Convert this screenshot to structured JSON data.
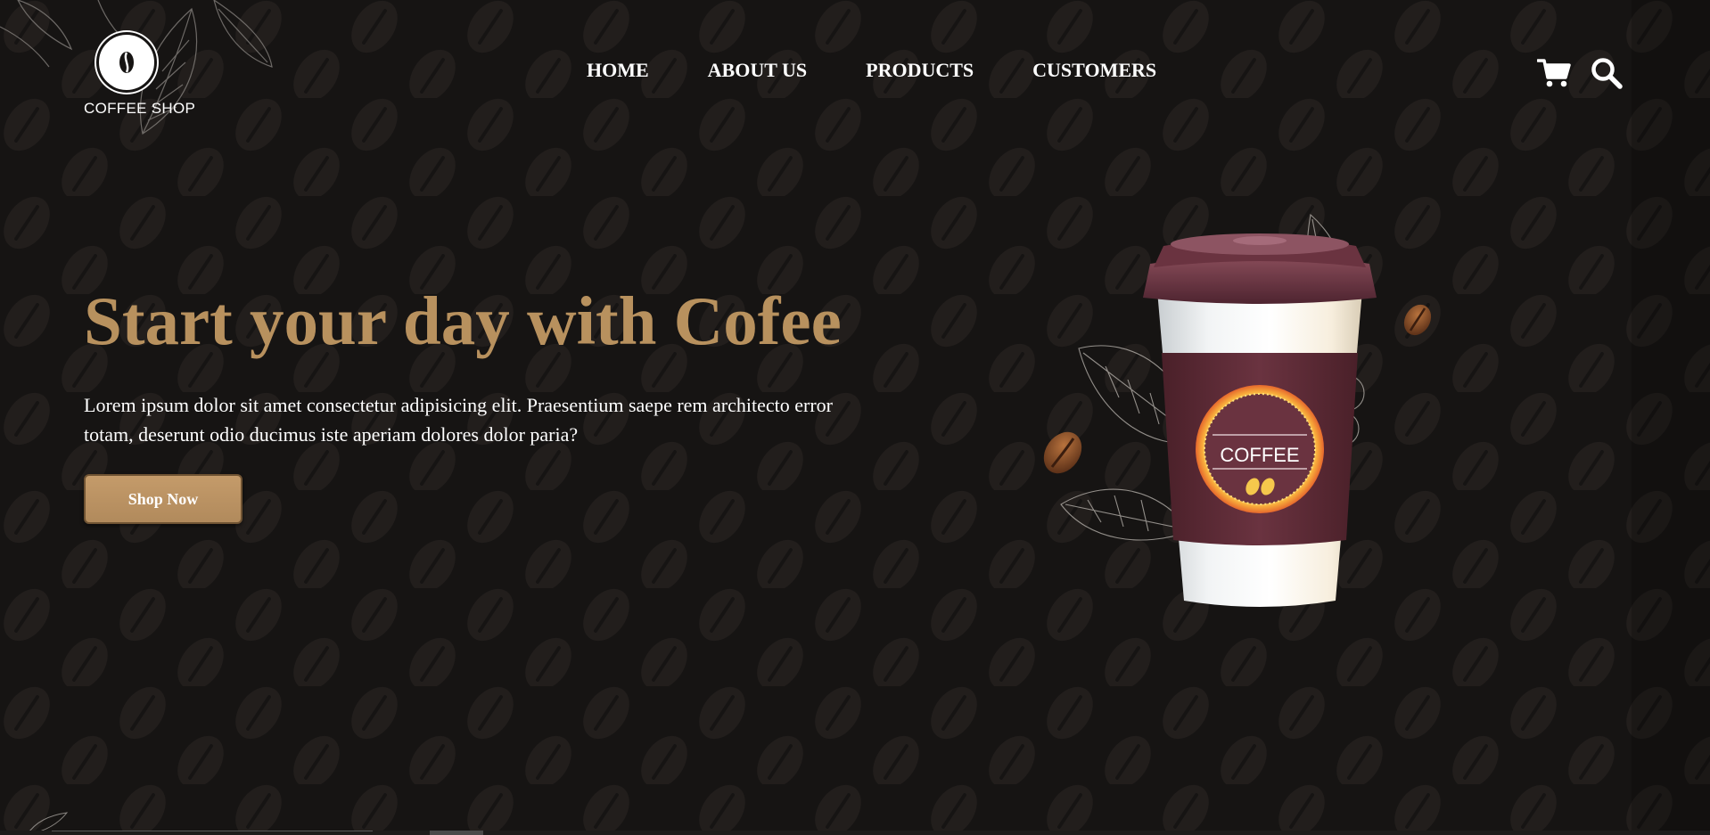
{
  "brand": {
    "name": "COFFEE SHOP",
    "logo_icon": "coffee-bean-icon"
  },
  "nav": {
    "items": [
      {
        "label": "HOME"
      },
      {
        "label": "ABOUT US"
      },
      {
        "label": "PRODUCTS"
      },
      {
        "label": "CUSTOMERS"
      }
    ]
  },
  "header_icons": {
    "cart": "cart-icon",
    "search": "search-icon"
  },
  "hero": {
    "title": "Start your day with Cofee",
    "text": "Lorem ipsum dolor sit amet consectetur adipisicing elit. Praesentium saepe rem architecto error totam, deserunt odio ducimus iste aperiam dolores dolor paria?",
    "button_label": "Shop Now"
  },
  "cup": {
    "label": "COFFEE"
  },
  "colors": {
    "background": "#161413",
    "accent": "#b8915e",
    "cup_brown": "#5b2b36",
    "text": "#ffffff"
  }
}
